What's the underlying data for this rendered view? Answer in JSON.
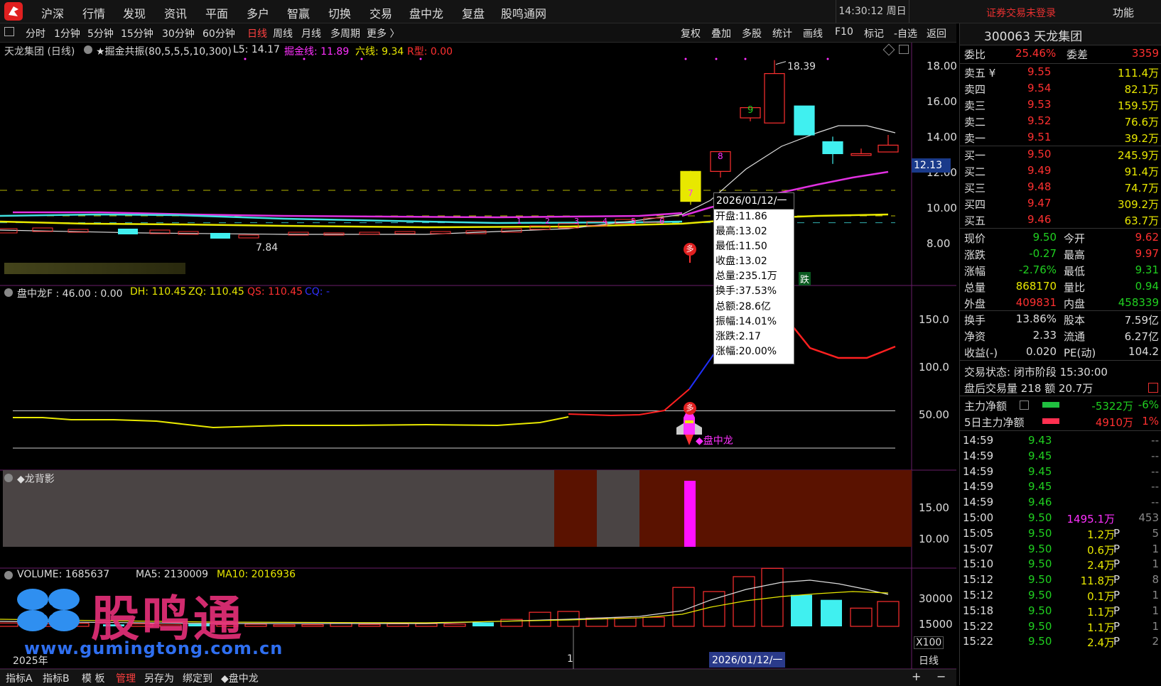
{
  "app": {
    "menu": [
      "沪深",
      "行情",
      "发现",
      "资讯",
      "平面",
      "多户",
      "智赢",
      "切换",
      "交易",
      "盘中龙",
      "复盘",
      "股鸣通网"
    ],
    "clock": "14:30:12 周日",
    "login_status": "证券交易未登录",
    "function_label": "功能"
  },
  "periods": [
    "分时",
    "1分钟",
    "5分钟",
    "15分钟",
    "30分钟",
    "60分钟",
    "日线",
    "周线",
    "月线",
    "多周期",
    "更多 〉"
  ],
  "active_period": "日线",
  "tools": [
    "复权",
    "叠加",
    "多股",
    "统计",
    "画线",
    "F10",
    "标记",
    "-自选",
    "返回"
  ],
  "main_panel": {
    "title": "天龙集团 (日线)",
    "indicator_name": "★掘金共振(80,5,5,5,10,300)",
    "l5": "L5: 14.17",
    "jjx": "掘金线: 11.89",
    "lx": "六线: 9.34",
    "rx": "R型: 0.00",
    "y_ticks": [
      "18.00",
      "16.00",
      "14.00",
      "12.00",
      "10.00",
      "8.00"
    ],
    "current_price_tag": "12.13",
    "high_label": "18.39",
    "low_label": "7.84",
    "signal_labels": [
      "多",
      "跌"
    ],
    "candle_numbers": [
      "7",
      "8",
      "9"
    ]
  },
  "tooltip": {
    "date": "2026/01/12/一",
    "lines": [
      "开盘:11.86",
      "最高:13.02",
      "最低:11.50",
      "收盘:13.02",
      "总量:235.1万",
      "换手:37.53%",
      "总额:28.6亿",
      "振幅:14.01%",
      "涨跌:2.17",
      "涨幅:20.00%"
    ]
  },
  "panel2": {
    "title": "盘中龙F : 46.00 : 0.00",
    "dh": "DH: 110.45",
    "zq": "ZQ: 110.45",
    "qs": "QS: 110.45",
    "cq": "CQ: -",
    "y_ticks": [
      "150.0",
      "100.0",
      "50.00"
    ],
    "rocket_label": "◆盘中龙",
    "signal": "多"
  },
  "panel3": {
    "title": "◆龙背影",
    "y_ticks": [
      "15.00",
      "10.00"
    ]
  },
  "panel4": {
    "volume": "VOLUME: 1685637",
    "ma5": "MA5: 2130009",
    "ma10": "MA10: 2016936",
    "y_ticks": [
      "30000",
      "15000"
    ],
    "unit": "X100",
    "x_labels": [
      "2025年",
      "1",
      "2026/01/12/一"
    ],
    "period_label": "日线",
    "watermark": "股鸣通",
    "watermark_url": "www.gumingtong.com.cn"
  },
  "bottom_tabs": [
    "指标A",
    "指标B",
    "模 板",
    "管理",
    "另存为",
    "绑定到",
    "◆盘中龙"
  ],
  "bottom_active": "管理",
  "stock": {
    "code_name": "300063 天龙集团",
    "wei_bi_label": "委比",
    "wei_bi": "25.46%",
    "wei_cha_label": "委差",
    "wei_cha": "3359",
    "asks": [
      {
        "label": "卖五 ¥",
        "price": "9.55",
        "vol": "111.4万"
      },
      {
        "label": "卖四",
        "price": "9.54",
        "vol": "82.1万"
      },
      {
        "label": "卖三",
        "price": "9.53",
        "vol": "159.5万"
      },
      {
        "label": "卖二",
        "price": "9.52",
        "vol": "76.6万"
      },
      {
        "label": "卖一",
        "price": "9.51",
        "vol": "39.2万"
      }
    ],
    "bids": [
      {
        "label": "买一",
        "price": "9.50",
        "vol": "245.9万"
      },
      {
        "label": "买二",
        "price": "9.49",
        "vol": "91.4万"
      },
      {
        "label": "买三",
        "price": "9.48",
        "vol": "74.7万"
      },
      {
        "label": "买四",
        "price": "9.47",
        "vol": "309.2万"
      },
      {
        "label": "买五",
        "price": "9.46",
        "vol": "63.7万"
      }
    ],
    "stats": [
      {
        "l1": "现价",
        "v1": "9.50",
        "c1": "green",
        "l2": "今开",
        "v2": "9.62",
        "c2": "red"
      },
      {
        "l1": "涨跌",
        "v1": "-0.27",
        "c1": "green",
        "l2": "最高",
        "v2": "9.97",
        "c2": "red"
      },
      {
        "l1": "涨幅",
        "v1": "-2.76%",
        "c1": "green",
        "l2": "最低",
        "v2": "9.31",
        "c2": "green"
      },
      {
        "l1": "总量",
        "v1": "868170",
        "c1": "yellow",
        "l2": "量比",
        "v2": "0.94",
        "c2": "green"
      },
      {
        "l1": "外盘",
        "v1": "409831",
        "c1": "red",
        "l2": "内盘",
        "v2": "458339",
        "c2": "green"
      },
      {
        "l1": "换手",
        "v1": "13.86%",
        "c1": "white",
        "l2": "股本",
        "v2": "7.59亿",
        "c2": "white"
      },
      {
        "l1": "净资",
        "v1": "2.33",
        "c1": "white",
        "l2": "流通",
        "v2": "6.27亿",
        "c2": "white"
      },
      {
        "l1": "收益(-)",
        "v1": "0.020",
        "c1": "white",
        "l2": "PE(动)",
        "v2": "104.2",
        "c2": "white"
      }
    ],
    "trade_status": "交易状态: 闭市阶段 15:30:00",
    "after_hours": "盘后交易量 218 额 20.7万",
    "main_net": {
      "label": "主力净额",
      "value": "-5322万",
      "pct": "-6%"
    },
    "main_net5": {
      "label": "5日主力净额",
      "value": "4910万",
      "pct": "1%"
    },
    "ticks": [
      {
        "t": "14:59",
        "p": "9.43",
        "v": "",
        "f": "",
        "n": "--"
      },
      {
        "t": "14:59",
        "p": "9.45",
        "v": "",
        "f": "",
        "n": "--"
      },
      {
        "t": "14:59",
        "p": "9.45",
        "v": "",
        "f": "",
        "n": "--"
      },
      {
        "t": "14:59",
        "p": "9.45",
        "v": "",
        "f": "",
        "n": "--"
      },
      {
        "t": "14:59",
        "p": "9.46",
        "v": "",
        "f": "",
        "n": "--"
      },
      {
        "t": "15:00",
        "p": "9.50",
        "v": "1495.1万",
        "f": "",
        "n": "453"
      },
      {
        "t": "15:05",
        "p": "9.50",
        "v": "1.2万",
        "f": "P",
        "n": "5"
      },
      {
        "t": "15:07",
        "p": "9.50",
        "v": "0.6万",
        "f": "P",
        "n": "1"
      },
      {
        "t": "15:10",
        "p": "9.50",
        "v": "2.4万",
        "f": "P",
        "n": "1"
      },
      {
        "t": "15:12",
        "p": "9.50",
        "v": "11.8万",
        "f": "P",
        "n": "8"
      },
      {
        "t": "15:12",
        "p": "9.50",
        "v": "0.1万",
        "f": "P",
        "n": "1"
      },
      {
        "t": "15:18",
        "p": "9.50",
        "v": "1.1万",
        "f": "P",
        "n": "1"
      },
      {
        "t": "15:22",
        "p": "9.50",
        "v": "1.1万",
        "f": "P",
        "n": "1"
      },
      {
        "t": "15:22",
        "p": "9.50",
        "v": "2.4万",
        "f": "P",
        "n": "2"
      }
    ]
  },
  "colors": {
    "up": "#ff3030",
    "down": "#40f0f0",
    "accent": "#ff30ff",
    "yellow": "#e8e800"
  }
}
